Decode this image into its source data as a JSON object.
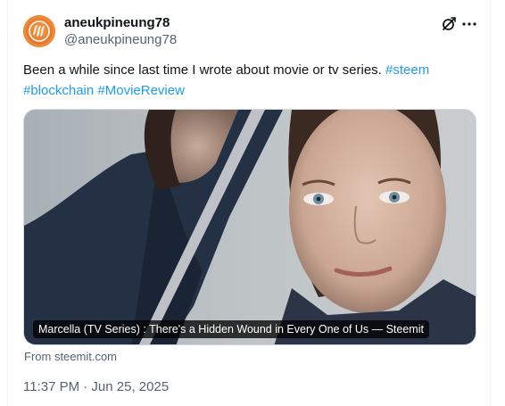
{
  "author": {
    "display_name": "aneukpineung78",
    "handle": "@aneukpineung78",
    "avatar_icon": "steem-logo-icon"
  },
  "header_actions": {
    "grok_icon": "grok-icon",
    "more_icon": "more-options-icon"
  },
  "tweet": {
    "text": "Been a while since last time I wrote about movie or tv series.",
    "hashtags": [
      "#steem",
      "#blockchain",
      "#MovieReview"
    ]
  },
  "link_card": {
    "caption": "Marcella (TV Series) : There's a Hidden Wound in Every One of Us — Steemit",
    "source": "From steemit.com"
  },
  "timestamp": "11:37 PM · Jun 25, 2025",
  "colors": {
    "accent": "#1d9bf0",
    "secondary_text": "#536471",
    "primary_text": "#0f1419"
  }
}
